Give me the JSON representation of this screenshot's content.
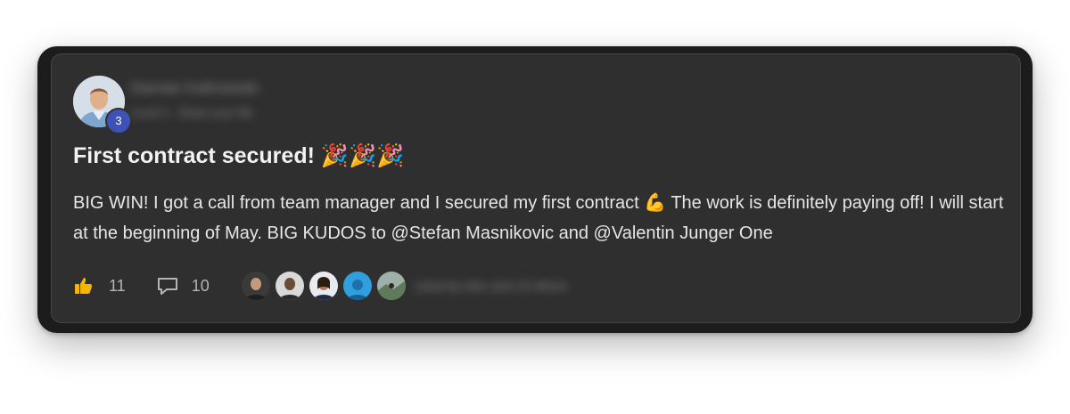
{
  "author": {
    "name": "Damian Kalinowski",
    "subtitle": "Level 3 · Share your life",
    "level": "3",
    "avatar_icon": "user-avatar-photo"
  },
  "post": {
    "title": "First contract secured! 🎉🎉🎉",
    "body": "BIG WIN! I got a call from team manager and I secured my first contract 💪 The work is definitely paying off! I will start at the beginning of May. BIG KUDOS to @Stefan Masnikovic and @Valentin Junger One"
  },
  "footer": {
    "likes_icon": "thumbs-up-icon",
    "likes": "11",
    "comments_icon": "comment-icon",
    "comments": "10",
    "reactors_text": "Liked by Alex and 10 others"
  },
  "colors": {
    "accent": "#3f51b5",
    "like_icon": "#f2b705",
    "card_background": "#2f2f2f"
  }
}
